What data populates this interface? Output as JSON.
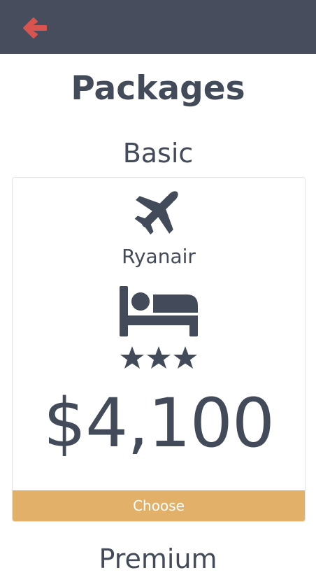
{
  "header": {
    "back_icon": "arrow-left-icon",
    "accent_color": "#d9534f",
    "background_color": "#474d5d"
  },
  "page_title": "Packages",
  "packages": [
    {
      "name": "Basic",
      "flight_icon": "plane-icon",
      "airline": "Ryanair",
      "hotel_icon": "bed-icon",
      "hotel_stars": 3,
      "price": "$4,100",
      "choose_label": "Choose",
      "button_color": "#e2b069"
    },
    {
      "name": "Premium"
    }
  ]
}
